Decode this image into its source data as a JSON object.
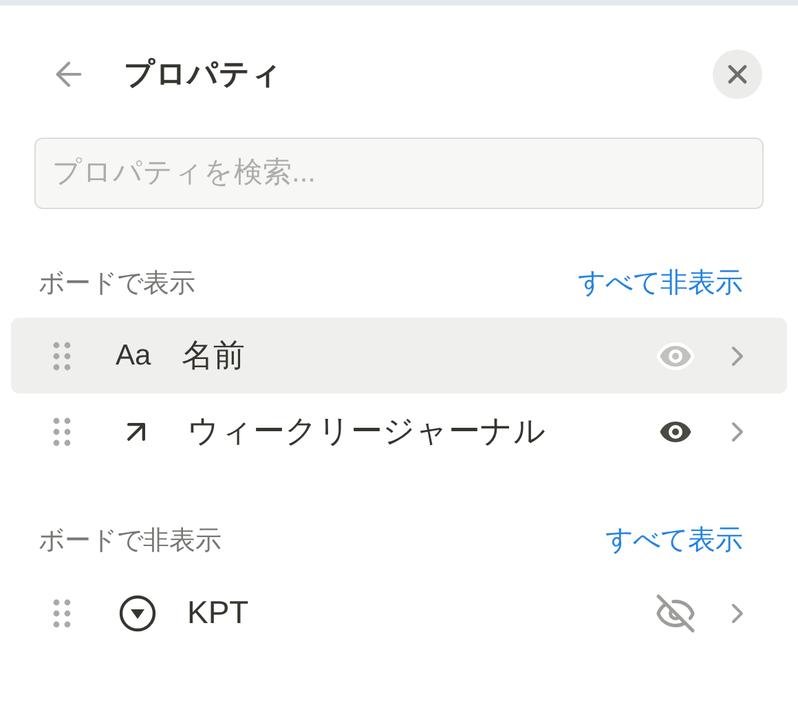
{
  "header": {
    "title": "プロパティ"
  },
  "search": {
    "placeholder": "プロパティを検索..."
  },
  "sections": [
    {
      "label": "ボードで表示",
      "action": "すべて非表示",
      "properties": [
        {
          "kind": "title",
          "icon_text": "Aa",
          "label": "名前",
          "visible": true,
          "disabled": true,
          "selected": true
        },
        {
          "kind": "relation",
          "label": "ウィークリージャーナル",
          "visible": true,
          "disabled": false,
          "selected": false
        }
      ]
    },
    {
      "label": "ボードで非表示",
      "action": "すべて表示",
      "properties": [
        {
          "kind": "select",
          "label": "KPT",
          "visible": false,
          "disabled": false,
          "selected": false
        }
      ]
    }
  ]
}
